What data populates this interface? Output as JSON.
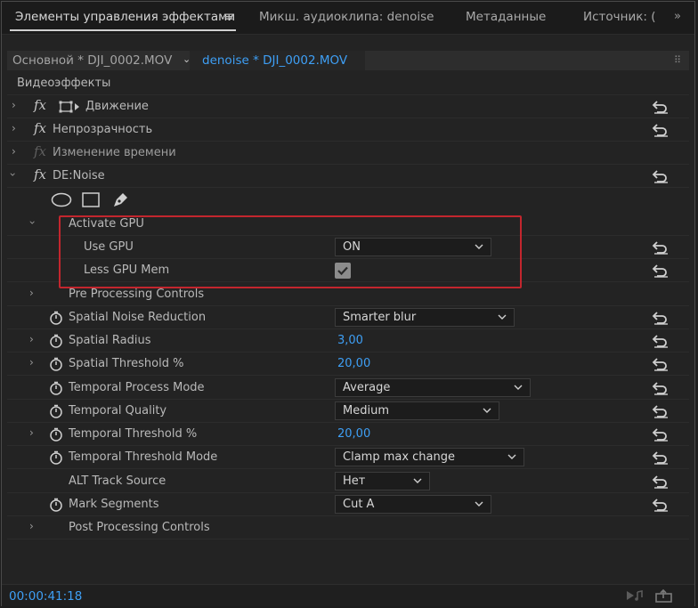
{
  "tabs": [
    {
      "label": "Элементы управления эффектами",
      "active": true
    },
    {
      "label": "Микш. аудиоклипа: denoise"
    },
    {
      "label": "Метаданные"
    },
    {
      "label": "Источник: ("
    }
  ],
  "clipbar": {
    "master_label": "Основной * DJI_0002.MOV",
    "active_label": "denoise * DJI_0002.MOV"
  },
  "section_title": "Видеоэффекты",
  "effects": {
    "motion": "Движение",
    "opacity": "Непрозрачность",
    "time_remap": "Изменение времени",
    "denoise": "DE:Noise"
  },
  "fx_glyph": "fx",
  "params": {
    "activate_gpu": "Activate GPU",
    "use_gpu": {
      "label": "Use GPU",
      "value": "ON"
    },
    "less_gpu_mem": {
      "label": "Less GPU Mem",
      "checked": true
    },
    "pre_processing": "Pre Processing Controls",
    "spatial_noise_reduction": {
      "label": "Spatial Noise Reduction",
      "value": "Smarter blur"
    },
    "spatial_radius": {
      "label": "Spatial Radius",
      "value": "3,00"
    },
    "spatial_threshold": {
      "label": "Spatial Threshold %",
      "value": "20,00"
    },
    "temporal_process_mode": {
      "label": "Temporal Process Mode",
      "value": "Average"
    },
    "temporal_quality": {
      "label": "Temporal Quality",
      "value": "Medium"
    },
    "temporal_threshold": {
      "label": "Temporal Threshold %",
      "value": "20,00"
    },
    "temporal_threshold_mode": {
      "label": "Temporal Threshold Mode",
      "value": "Clamp max change"
    },
    "alt_track_source": {
      "label": "ALT Track Source",
      "value": "Нет"
    },
    "mark_segments": {
      "label": "Mark Segments",
      "value": "Cut A"
    },
    "post_processing": "Post Processing Controls"
  },
  "footer": {
    "timecode": "00:00:41:18"
  },
  "colors": {
    "accent": "#3e9ff5",
    "highlight": "#c3262e"
  }
}
